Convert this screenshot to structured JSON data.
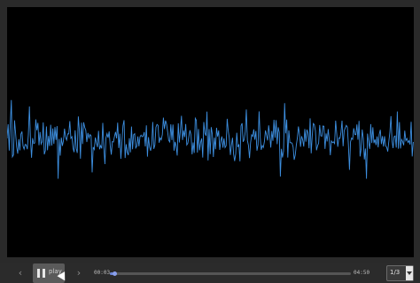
{
  "player": {
    "play_label": "play",
    "prev_icon": "chevron-left-icon",
    "next_icon": "chevron-right-icon",
    "pause_icon": "pause-icon",
    "elapsed": "00:03",
    "duration": "04:50",
    "progress": 0.01,
    "page_value": "1/3"
  },
  "waveform": {
    "color": "#3d8fe0",
    "background": "#000000"
  }
}
